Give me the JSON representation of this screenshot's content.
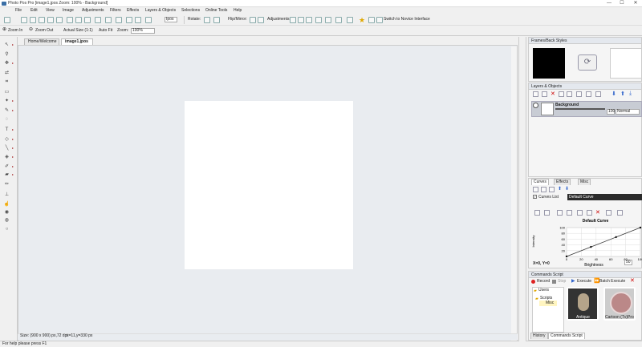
{
  "window": {
    "title": "Photo Pos Pro [image1.jpos Zoom: 100% - Background]",
    "min": "—",
    "max": "☐",
    "close": "✕"
  },
  "menu": [
    "File",
    "Edit",
    "View",
    "Image",
    "Adjustments",
    "Filters",
    "Effects",
    "Layers & Objects",
    "Selections",
    "Online Tools",
    "Help"
  ],
  "toolbar1": {
    "format": "Ipos",
    "rotate": "Rotate:",
    "flip": "Flip/Mirror:",
    "adjustments": "Adjustments:",
    "novice": "Switch to Novice Interface"
  },
  "toolbar2": {
    "zoom_in": "Zoom In",
    "zoom_out": "Zoom Out",
    "actual_size": "Actual Size (1:1)",
    "auto_fit": "Auto Fit",
    "zoom_label": "Zoom:",
    "zoom_value": "100%"
  },
  "tabs": [
    "Home/Welcome",
    "image1.jpos"
  ],
  "status": {
    "size": "Size: (900 x 900) px,72 dpi",
    "coords": "x=11,y=330 px",
    "help": "For help please press F1"
  },
  "frames": {
    "title": "Frames/Back Styles"
  },
  "layers": {
    "title": "Layers & Objects",
    "layer_name": "Background",
    "opacity": "100",
    "blend": "Normal"
  },
  "curves": {
    "tabs": [
      "Curves",
      "Effects",
      "Misc"
    ],
    "curves_list_label": "Curves List",
    "curve_name": "Default Curve",
    "chart_title": "Default Curve",
    "ylabel": "Intensity",
    "xlabel": "Brightness",
    "coords": "X=0, Y=0",
    "value": "50",
    "xticks": [
      "0",
      "20",
      "40",
      "60",
      "80",
      "100"
    ],
    "yticks": [
      "100",
      "80",
      "60",
      "40",
      "20"
    ]
  },
  "commands": {
    "title": "Commands Script",
    "record": "Record",
    "stop": "Stop",
    "execute": "Execute",
    "batch": "Batch Execute",
    "tree": [
      "Users",
      "Scripts",
      "Misc"
    ],
    "thumbs": [
      "Antique",
      "Cartoon (Tv)Pro"
    ],
    "bottom_tabs": [
      "History",
      "Commands Script"
    ]
  },
  "chart_data": {
    "type": "line",
    "title": "Default Curve",
    "xlabel": "Brightness",
    "ylabel": "Intensity",
    "x": [
      0,
      33,
      67,
      100
    ],
    "y": [
      0,
      33,
      67,
      100
    ],
    "xlim": [
      0,
      100
    ],
    "ylim": [
      0,
      100
    ]
  },
  "accent": "#3a6ea5"
}
